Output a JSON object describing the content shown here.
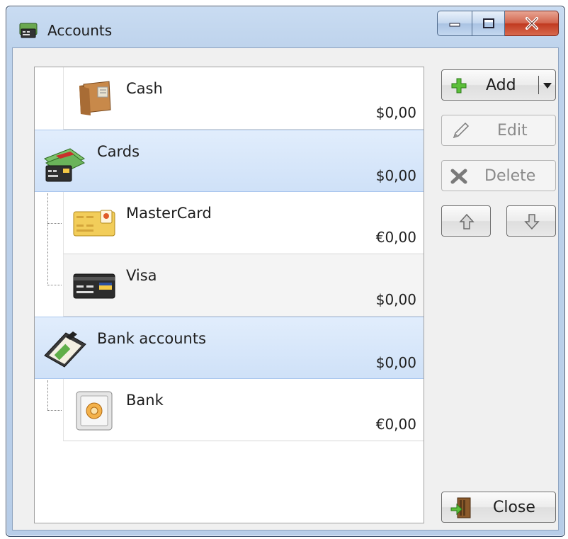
{
  "window": {
    "title": "Accounts",
    "icons": {
      "app": "accounts-app-icon",
      "minimize": "minimize-icon",
      "maximize": "maximize-icon",
      "close": "close-x-icon"
    }
  },
  "accounts": {
    "cash": {
      "name": "Cash",
      "amount": "$0,00",
      "icon": "wallet-icon"
    },
    "cards": {
      "name": "Cards",
      "amount": "$0,00",
      "icon": "money-and-cards-icon"
    },
    "mastercard": {
      "name": "MasterCard",
      "amount": "€0,00",
      "icon": "gold-credit-card-icon"
    },
    "visa": {
      "name": "Visa",
      "amount": "$0,00",
      "icon": "black-credit-card-icon"
    },
    "bank_accounts": {
      "name": "Bank accounts",
      "amount": "$0,00",
      "icon": "bank-accounts-icon"
    },
    "bank": {
      "name": "Bank",
      "amount": "€0,00",
      "icon": "safe-icon"
    }
  },
  "buttons": {
    "add": "Add",
    "edit": "Edit",
    "delete": "Delete",
    "close": "Close",
    "move_up": "move-up-arrow-icon",
    "move_down": "move-down-arrow-icon"
  },
  "colors": {
    "selection": "#cfe1f8",
    "accent": "#3f9d2f",
    "close_button": "#c0391f"
  }
}
